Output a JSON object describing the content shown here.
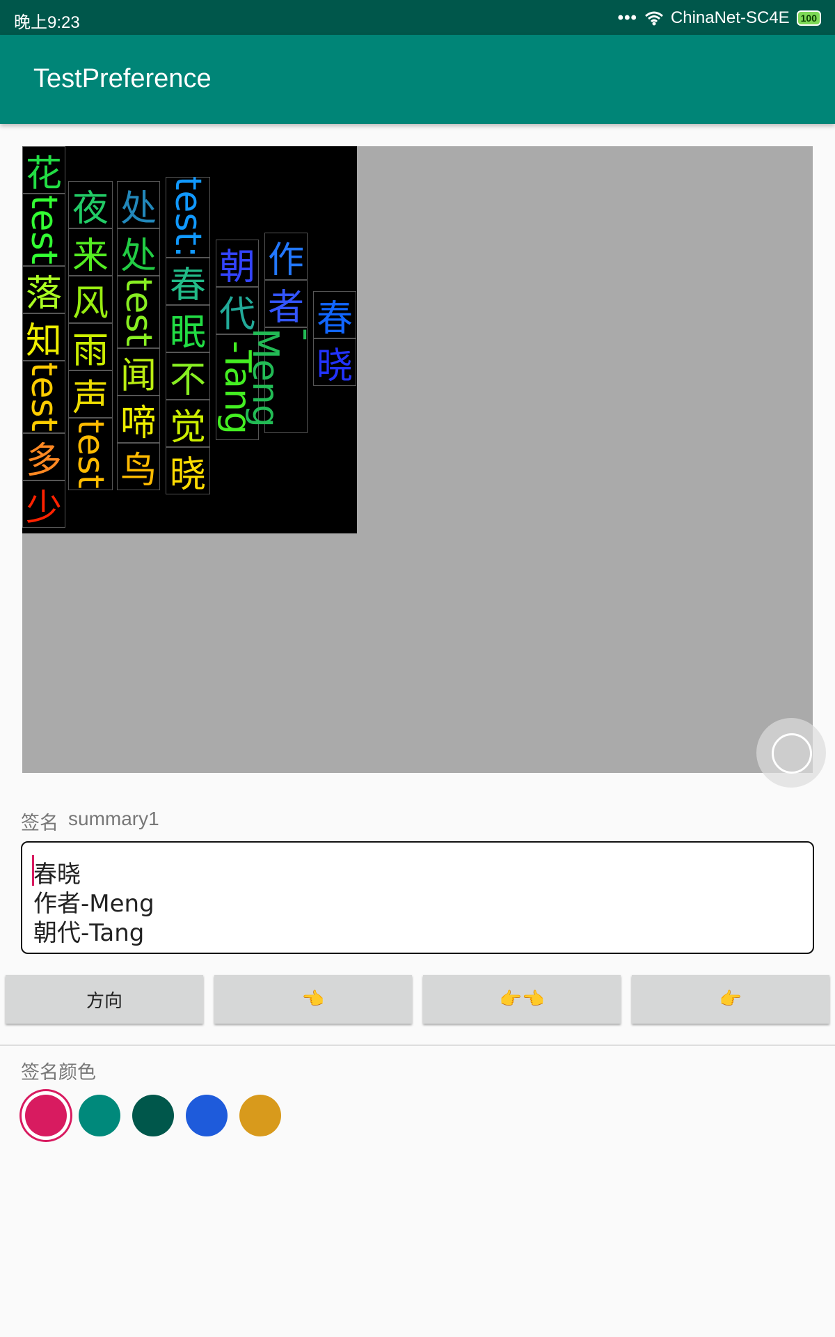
{
  "status": {
    "time": "晚上9:23",
    "dots": "•••",
    "network": "ChinaNet-SC4E",
    "battery": "100"
  },
  "appbar": {
    "title": "TestPreference"
  },
  "preview": {
    "columns": [
      {
        "cells": [
          {
            "text": "花",
            "color": "#22dd44",
            "rot": false
          },
          {
            "text": "test",
            "color": "#33ff33",
            "rot": true
          },
          {
            "text": "落",
            "color": "#aaff22",
            "rot": false
          },
          {
            "text": "知",
            "color": "#eeee00",
            "rot": false
          },
          {
            "text": "test",
            "color": "#ffcc00",
            "rot": true
          },
          {
            "text": "多",
            "color": "#ff8822",
            "rot": false
          },
          {
            "text": "少",
            "color": "#ff2200",
            "rot": false
          }
        ]
      },
      {
        "cells": [
          {
            "text": "夜",
            "color": "#22cc66",
            "rot": false
          },
          {
            "text": "来",
            "color": "#55ee22",
            "rot": false
          },
          {
            "text": "风",
            "color": "#99ee11",
            "rot": false
          },
          {
            "text": "雨",
            "color": "#ccee00",
            "rot": false
          },
          {
            "text": "声",
            "color": "#eedd00",
            "rot": false
          },
          {
            "text": "test",
            "color": "#ffbb00",
            "rot": true
          }
        ]
      },
      {
        "cells": [
          {
            "text": "处",
            "color": "#2288bb",
            "rot": false
          },
          {
            "text": "处",
            "color": "#22cc44",
            "rot": false
          },
          {
            "text": "test",
            "color": "#88ee22",
            "rot": true
          },
          {
            "text": "闻",
            "color": "#bbee11",
            "rot": false
          },
          {
            "text": "啼",
            "color": "#eeee00",
            "rot": false
          },
          {
            "text": "鸟",
            "color": "#ffbb00",
            "rot": false
          }
        ]
      },
      {
        "cells": [
          {
            "text": "test:",
            "color": "#1199ff",
            "rot": true
          },
          {
            "text": "春",
            "color": "#22bb88",
            "rot": false
          },
          {
            "text": "眠",
            "color": "#22dd44",
            "rot": false
          },
          {
            "text": "不",
            "color": "#88ee22",
            "rot": false
          },
          {
            "text": "觉",
            "color": "#ccee00",
            "rot": false
          },
          {
            "text": "晓",
            "color": "#ffdd00",
            "rot": false
          }
        ]
      },
      {
        "cells": [
          {
            "text": "朝",
            "color": "#3344ff",
            "rot": false
          },
          {
            "text": "代",
            "color": "#22aa99",
            "rot": false
          },
          {
            "text": "-Tang",
            "color": "#44ee22",
            "rot": true
          }
        ]
      },
      {
        "cells": [
          {
            "text": "作",
            "color": "#2277ff",
            "rot": false
          },
          {
            "text": "者",
            "color": "#3355ff",
            "rot": false
          },
          {
            "text": "-Meng",
            "color": "#22bb55",
            "rot": true
          }
        ]
      },
      {
        "cells": [
          {
            "text": "春",
            "color": "#1166ff",
            "rot": false
          },
          {
            "text": "晓",
            "color": "#2233ff",
            "rot": false
          }
        ]
      }
    ]
  },
  "signature": {
    "label": "签名",
    "summary": "summary1",
    "lines": [
      "春晓",
      "作者-Meng",
      "朝代-Tang"
    ]
  },
  "buttons": {
    "direction": "方向",
    "left": "👈",
    "both": "👉👈",
    "right": "👉"
  },
  "color_section": {
    "label": "签名颜色",
    "swatches": [
      "#d81b60",
      "#00897b",
      "#00574b",
      "#1e5bdb",
      "#d89a1c"
    ],
    "selected_index": 0
  }
}
